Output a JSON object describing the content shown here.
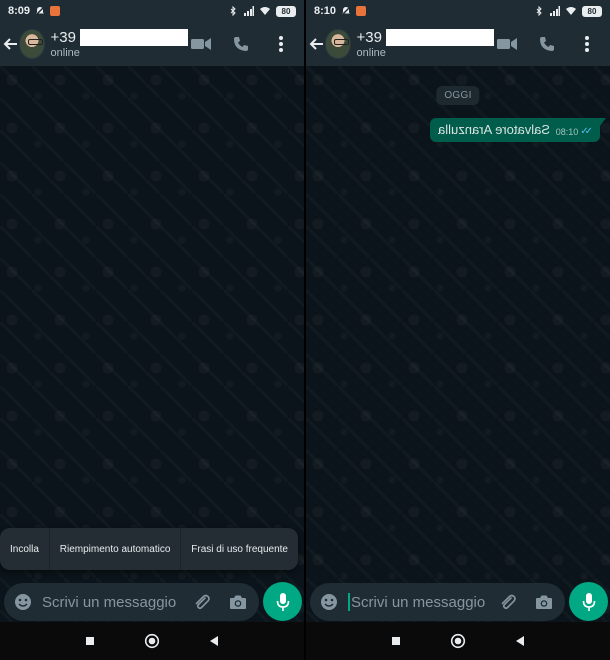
{
  "colors": {
    "app_bar": "#1f2c34",
    "chat_background": "#0b141a",
    "outgoing_bubble": "#005c4b",
    "accent_green": "#00a884",
    "read_ticks": "#53bdeb"
  },
  "screens": [
    {
      "status_bar": {
        "time": "8:09",
        "battery": "80"
      },
      "header": {
        "contact_prefix": "+39",
        "contact_status": "online"
      },
      "paste_menu": {
        "items": [
          "Incolla",
          "Riempimento automatico",
          "Frasi di uso frequente"
        ]
      },
      "composer": {
        "placeholder": "Scrivi un messaggio"
      },
      "icons": [
        "back-arrow-icon",
        "video-call-icon",
        "phone-icon",
        "more-vert-icon",
        "emoji-icon",
        "attach-icon",
        "camera-icon",
        "mic-icon"
      ]
    },
    {
      "status_bar": {
        "time": "8:10",
        "battery": "80"
      },
      "header": {
        "contact_prefix": "+39",
        "contact_status": "online"
      },
      "chat": {
        "date_chip": "OGGI",
        "message": {
          "text": "Salvatore Aranzulla",
          "time": "08:10",
          "status": "read",
          "mirrored": true
        }
      },
      "composer": {
        "placeholder": "Scrivi un messaggio",
        "focused": true
      },
      "icons": [
        "back-arrow-icon",
        "video-call-icon",
        "phone-icon",
        "more-vert-icon",
        "emoji-icon",
        "attach-icon",
        "camera-icon",
        "mic-icon"
      ]
    }
  ]
}
